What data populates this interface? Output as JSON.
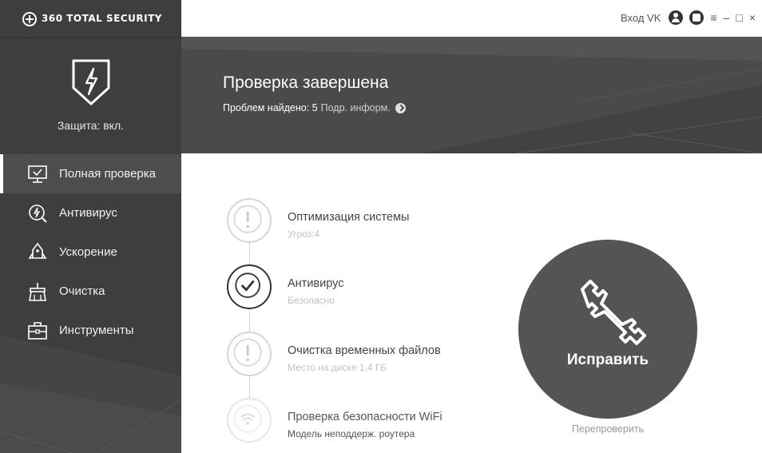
{
  "app": {
    "brand": "360 TOTAL SECURITY"
  },
  "topbar": {
    "login": "Вход VK"
  },
  "sidebar": {
    "protection_status": "Защита: вкл.",
    "items": [
      {
        "label": "Полная проверка",
        "icon": "monitor-check-icon",
        "active": true
      },
      {
        "label": "Антивирус",
        "icon": "antivirus-search-icon",
        "active": false
      },
      {
        "label": "Ускорение",
        "icon": "rocket-icon",
        "active": false
      },
      {
        "label": "Очистка",
        "icon": "broom-icon",
        "active": false
      },
      {
        "label": "Инструменты",
        "icon": "toolbox-icon",
        "active": false
      }
    ]
  },
  "banner": {
    "title": "Проверка завершена",
    "problems_label": "Проблем найдено: 5",
    "more_link": "Подр. информ."
  },
  "results": [
    {
      "title": "Оптимизация системы",
      "subtitle": "Угроз:4",
      "status": "warning",
      "icon": "exclamation-icon"
    },
    {
      "title": "Антивирус",
      "subtitle": "Безопасно",
      "status": "ok",
      "icon": "checkmark-icon"
    },
    {
      "title": "Очистка временных файлов",
      "subtitle": "Место на диске 1.4 ГБ",
      "status": "warning",
      "icon": "exclamation-icon"
    },
    {
      "title": "Проверка безопасности WiFi",
      "subtitle": "Модель неподдерж. роутера",
      "status": "disabled",
      "icon": "wifi-icon"
    }
  ],
  "actions": {
    "fix_label": "Исправить",
    "rescan_label": "Перепроверить"
  }
}
